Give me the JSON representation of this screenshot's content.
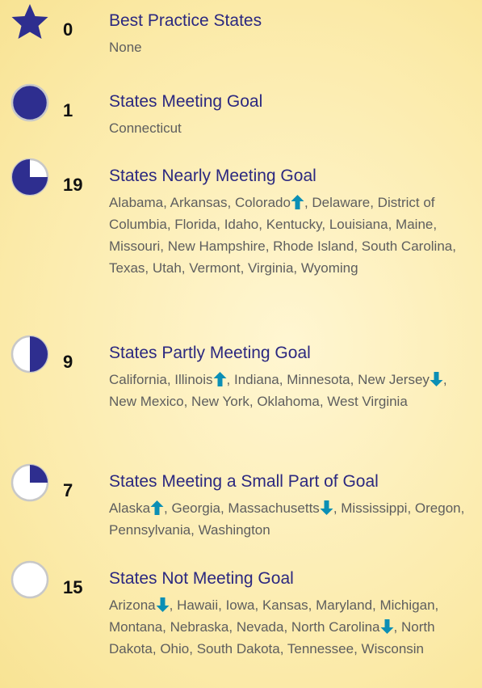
{
  "colors": {
    "navy": "#2e2e8f",
    "arrow": "#0b8fb5",
    "title": "#2b2880",
    "text": "#5e5e5e"
  },
  "categories": [
    {
      "icon": "star-icon",
      "count": "0",
      "title": "Best Practice States",
      "states": [
        {
          "name": "None"
        }
      ]
    },
    {
      "icon": "full-circle-icon",
      "count": "1",
      "title": "States Meeting Goal",
      "states": [
        {
          "name": "Connecticut"
        }
      ]
    },
    {
      "icon": "three-quarter-circle-icon",
      "count": "19",
      "title": "States Nearly Meeting Goal",
      "states": [
        {
          "name": "Alabama"
        },
        {
          "name": "Arkansas"
        },
        {
          "name": "Colorado",
          "trend": "up"
        },
        {
          "name": "Delaware"
        },
        {
          "name": "District of Columbia"
        },
        {
          "name": "Florida"
        },
        {
          "name": "Idaho"
        },
        {
          "name": "Kentucky"
        },
        {
          "name": "Louisiana"
        },
        {
          "name": "Maine"
        },
        {
          "name": "Missouri"
        },
        {
          "name": "New Hampshire"
        },
        {
          "name": "Rhode Island"
        },
        {
          "name": "South Carolina"
        },
        {
          "name": "Texas"
        },
        {
          "name": "Utah"
        },
        {
          "name": "Vermont"
        },
        {
          "name": "Virginia"
        },
        {
          "name": "Wyoming"
        }
      ]
    },
    {
      "icon": "half-circle-icon",
      "count": "9",
      "title": "States Partly Meeting Goal",
      "states": [
        {
          "name": "California"
        },
        {
          "name": "Illinois",
          "trend": "up"
        },
        {
          "name": "Indiana"
        },
        {
          "name": "Minnesota"
        },
        {
          "name": "New Jersey",
          "trend": "down"
        },
        {
          "name": "New Mexico"
        },
        {
          "name": "New York"
        },
        {
          "name": "Oklahoma"
        },
        {
          "name": "West Virginia"
        }
      ]
    },
    {
      "icon": "quarter-circle-icon",
      "count": "7",
      "title": "States Meeting a Small Part of Goal",
      "states": [
        {
          "name": "Alaska",
          "trend": "up"
        },
        {
          "name": "Georgia"
        },
        {
          "name": "Massachusetts",
          "trend": "down"
        },
        {
          "name": "Mississippi"
        },
        {
          "name": "Oregon"
        },
        {
          "name": "Pennsylvania"
        },
        {
          "name": "Washington"
        }
      ]
    },
    {
      "icon": "empty-circle-icon",
      "count": "15",
      "title": "States Not Meeting Goal",
      "states": [
        {
          "name": "Arizona",
          "trend": "down"
        },
        {
          "name": "Hawaii"
        },
        {
          "name": "Iowa"
        },
        {
          "name": "Kansas"
        },
        {
          "name": "Maryland"
        },
        {
          "name": "Michigan"
        },
        {
          "name": "Montana"
        },
        {
          "name": "Nebraska"
        },
        {
          "name": "Nevada"
        },
        {
          "name": "North Carolina",
          "trend": "down"
        },
        {
          "name": "North Dakota"
        },
        {
          "name": "Ohio"
        },
        {
          "name": "South Dakota"
        },
        {
          "name": "Tennessee"
        },
        {
          "name": "Wisconsin"
        }
      ]
    }
  ]
}
